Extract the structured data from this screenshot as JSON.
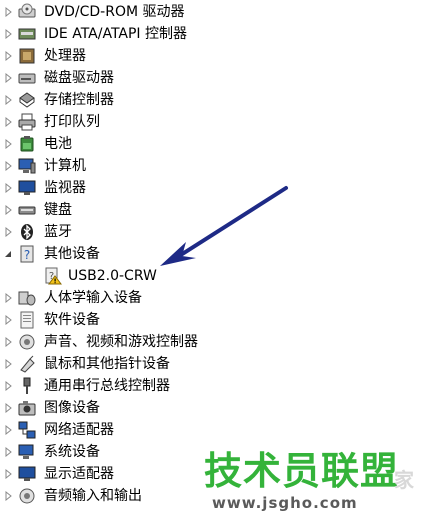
{
  "tree": {
    "items": [
      {
        "label": "DVD/CD-ROM 驱动器",
        "icon": "dvd-drive-icon",
        "expanded": false
      },
      {
        "label": "IDE ATA/ATAPI 控制器",
        "icon": "ide-controller-icon",
        "expanded": false
      },
      {
        "label": "处理器",
        "icon": "processor-icon",
        "expanded": false
      },
      {
        "label": "磁盘驱动器",
        "icon": "disk-drive-icon",
        "expanded": false
      },
      {
        "label": "存储控制器",
        "icon": "storage-controller-icon",
        "expanded": false
      },
      {
        "label": "打印队列",
        "icon": "printer-icon",
        "expanded": false
      },
      {
        "label": "电池",
        "icon": "battery-icon",
        "expanded": false
      },
      {
        "label": "计算机",
        "icon": "computer-icon",
        "expanded": false
      },
      {
        "label": "监视器",
        "icon": "monitor-icon",
        "expanded": false
      },
      {
        "label": "键盘",
        "icon": "keyboard-icon",
        "expanded": false
      },
      {
        "label": "蓝牙",
        "icon": "bluetooth-icon",
        "expanded": false
      },
      {
        "label": "其他设备",
        "icon": "other-devices-icon",
        "expanded": true
      },
      {
        "label": "USB2.0-CRW",
        "icon": "unknown-device-warning-icon",
        "child": true
      },
      {
        "label": "人体学输入设备",
        "icon": "hid-icon",
        "expanded": false
      },
      {
        "label": "软件设备",
        "icon": "software-device-icon",
        "expanded": false
      },
      {
        "label": "声音、视频和游戏控制器",
        "icon": "sound-icon",
        "expanded": false
      },
      {
        "label": "鼠标和其他指针设备",
        "icon": "mouse-icon",
        "expanded": false
      },
      {
        "label": "通用串行总线控制器",
        "icon": "usb-icon",
        "expanded": false
      },
      {
        "label": "图像设备",
        "icon": "imaging-device-icon",
        "expanded": false
      },
      {
        "label": "网络适配器",
        "icon": "network-adapter-icon",
        "expanded": false
      },
      {
        "label": "系统设备",
        "icon": "system-device-icon",
        "expanded": false
      },
      {
        "label": "显示适配器",
        "icon": "display-adapter-icon",
        "expanded": false
      },
      {
        "label": "音频输入和输出",
        "icon": "audio-io-icon",
        "expanded": false
      }
    ]
  },
  "watermark": {
    "main": "技术员联盟",
    "sub": "www.jsgho.com",
    "faint": "家"
  },
  "colors": {
    "arrow": "#1e2a86",
    "watermark_green": "#34b33a",
    "watermark_gray": "#5a5a5a"
  }
}
